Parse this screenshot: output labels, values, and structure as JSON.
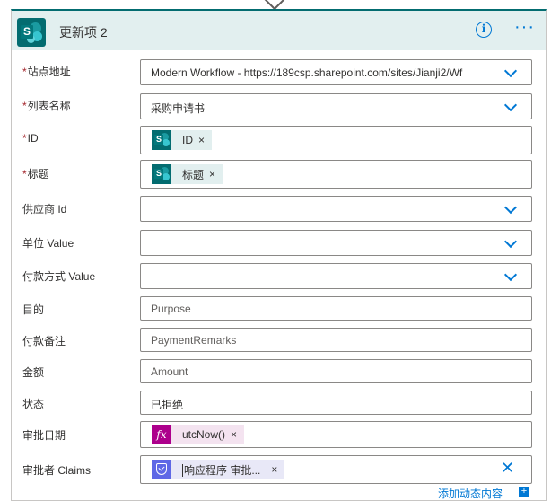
{
  "card": {
    "title": "更新项 2",
    "info_icon_glyph": "i",
    "more_icon_glyph": "···",
    "header_color": "#e2efef",
    "accent": "#036c70"
  },
  "fields": [
    {
      "label": "站点地址",
      "required": true,
      "value": "Modern Workflow - https://189csp.sharepoint.com/sites/Jianji2/Wf",
      "dropdown": true
    },
    {
      "label": "列表名称",
      "required": true,
      "value": "采购申请书",
      "dropdown": true
    },
    {
      "label": "ID",
      "required": true,
      "token": "ID",
      "token_icon": "sharepoint-icon"
    },
    {
      "label": "标题",
      "required": true,
      "token": "标题",
      "token_icon": "sharepoint-icon"
    },
    {
      "label": "供应商 Id",
      "required": false,
      "value": "",
      "dropdown": true
    },
    {
      "label": "单位 Value",
      "required": false,
      "value": "",
      "dropdown": true
    },
    {
      "label": "付款方式 Value",
      "required": false,
      "value": "",
      "dropdown": true
    },
    {
      "label": "目的",
      "required": false,
      "placeholder": "Purpose"
    },
    {
      "label": "付款备注",
      "required": false,
      "placeholder": "PaymentRemarks"
    },
    {
      "label": "金额",
      "required": false,
      "placeholder": "Amount"
    },
    {
      "label": "状态",
      "required": false,
      "value": "已拒绝"
    },
    {
      "label": "审批日期",
      "required": false,
      "token": "utcNow()",
      "token_icon": "fx-icon"
    },
    {
      "label": "审批者 Claims",
      "required": false,
      "token": "响应程序 审批...",
      "token_icon": "approvals-icon"
    }
  ],
  "required_mark": "*",
  "token_remove_glyph": "×",
  "fx_glyph": "fx",
  "sp_glyph": "S",
  "clear_glyph": "✕",
  "add_dynamic": {
    "label": "添加动态内容",
    "plus": "+"
  }
}
